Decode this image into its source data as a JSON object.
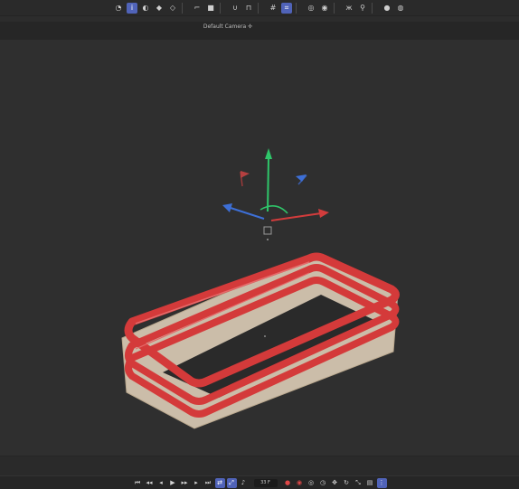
{
  "viewport": {
    "camera_label": "Default Camera ✢",
    "background": "#2f2f2f"
  },
  "colors": {
    "accent": "#5063b8",
    "axis_x": "#d23c3c",
    "axis_y": "#2fc66a",
    "axis_z": "#3d6fd6",
    "ring_red": "#d43a3a",
    "mesh_beige": "#cbbda9"
  },
  "top_toolbar": {
    "icons": [
      "cursor-icon",
      "info-icon",
      "contrast-icon",
      "cube-shaded-icon",
      "cube-wire-icon",
      "crop-icon",
      "square-icon",
      "magnet-icon",
      "lock-icon",
      "grid-icon",
      "grid-snap-icon",
      "circle-icon",
      "sphere-icon",
      "butterfly-icon",
      "brush-icon",
      "eye-icon",
      "visibility-icon"
    ]
  },
  "timeline": {
    "frame_value": "33 F",
    "icons": [
      "skip-start-icon",
      "step-back-icon",
      "play-back-icon",
      "play-icon",
      "step-forward-icon",
      "play-forward-icon",
      "skip-end-icon",
      "loop-icon",
      "range-icon",
      "audio-icon",
      "record-icon",
      "autokey-icon",
      "keyframe-icon",
      "clock-icon",
      "move-key-icon",
      "rotate-key-icon",
      "scale-key-icon",
      "param-key-icon",
      "grid-key-icon"
    ]
  }
}
